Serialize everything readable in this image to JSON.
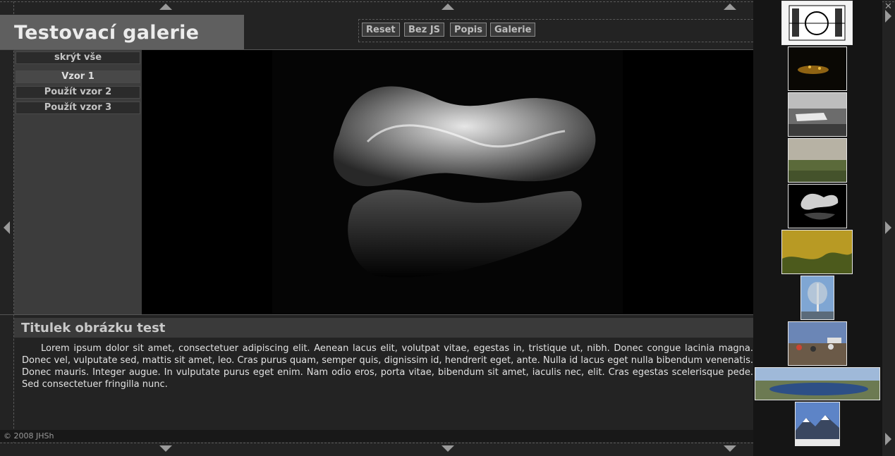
{
  "gallery": {
    "title": "Testovací galerie"
  },
  "toolbar": {
    "buttons": [
      {
        "label": "Reset"
      },
      {
        "label": "Bez JS"
      },
      {
        "label": "Popis"
      },
      {
        "label": "Galerie"
      }
    ]
  },
  "sidebar": {
    "hide_all": "skrýt vše",
    "items": [
      {
        "label": "Vzor 1",
        "active": true
      },
      {
        "label": "Použít vzor 2",
        "active": false
      },
      {
        "label": "Použít vzor 3",
        "active": false
      }
    ]
  },
  "caption": {
    "title": "Titulek obrázku test",
    "text": "Lorem ipsum dolor sit amet, consectetuer adipiscing elit. Aenean lacus elit, volutpat vitae, egestas in, tristique ut, nibh. Donec congue lacinia magna. Donec vel, vulputate sed, mattis sit amet, leo. Cras purus quam, semper quis, dignissim id, hendrerit eget, ante. Nulla id lacus eget nulla bibendum venenatis. Donec mauris. Integer augue. In vulputate purus eget enim. Nam odio eros, porta vitae, bibendum sit amet, iaculis nec, elit. Cras egestas scelerisque pede. Sed consectetuer fringilla nunc."
  },
  "footer": {
    "copyright": "© 2008 JHSh"
  },
  "thumbnails": [
    {
      "subject": "test-pattern"
    },
    {
      "subject": "night-city"
    },
    {
      "subject": "boats-bw"
    },
    {
      "subject": "landscape-haze"
    },
    {
      "subject": "glass-sculpture",
      "selected": true
    },
    {
      "subject": "yellow-grass"
    },
    {
      "subject": "birch-tree"
    },
    {
      "subject": "crowd-market"
    },
    {
      "subject": "lake-panorama"
    },
    {
      "subject": "mountains"
    }
  ],
  "icons": {
    "close": "close-icon",
    "nav_left": "arrow-left-icon",
    "nav_right": "arrow-right-icon",
    "nav_up": "arrow-up-icon",
    "nav_down": "arrow-down-icon"
  },
  "colors": {
    "background": "#232323",
    "title_box": "#5f5f5f",
    "viewer": "#000000"
  }
}
